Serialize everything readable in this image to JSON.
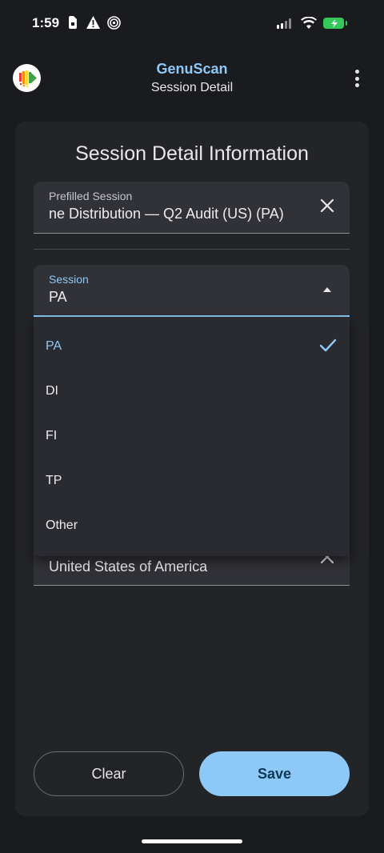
{
  "status_bar": {
    "time": "1:59",
    "icons": [
      "sim-card-icon",
      "warning-icon",
      "wireless-icon",
      "cellular-signal-icon",
      "wifi-icon",
      "battery-charging-icon"
    ],
    "battery_color": "#34c759"
  },
  "app_bar": {
    "title": "GenuScan",
    "subtitle": "Session Detail",
    "title_color": "#8ec8f6"
  },
  "card": {
    "title": "Session Detail Information"
  },
  "prefilled_session": {
    "label": "Prefilled Session",
    "value": "ne Distribution — Q2 Audit (US) (PA)"
  },
  "session": {
    "label": "Session",
    "value": "PA",
    "options": [
      {
        "label": "PA",
        "selected": true
      },
      {
        "label": "DI",
        "selected": false
      },
      {
        "label": "FI",
        "selected": false
      },
      {
        "label": "TP",
        "selected": false
      },
      {
        "label": "Other",
        "selected": false
      }
    ]
  },
  "country": {
    "value": "United States of America"
  },
  "actions": {
    "clear_label": "Clear",
    "save_label": "Save",
    "accent_color": "#8ec8f6"
  }
}
